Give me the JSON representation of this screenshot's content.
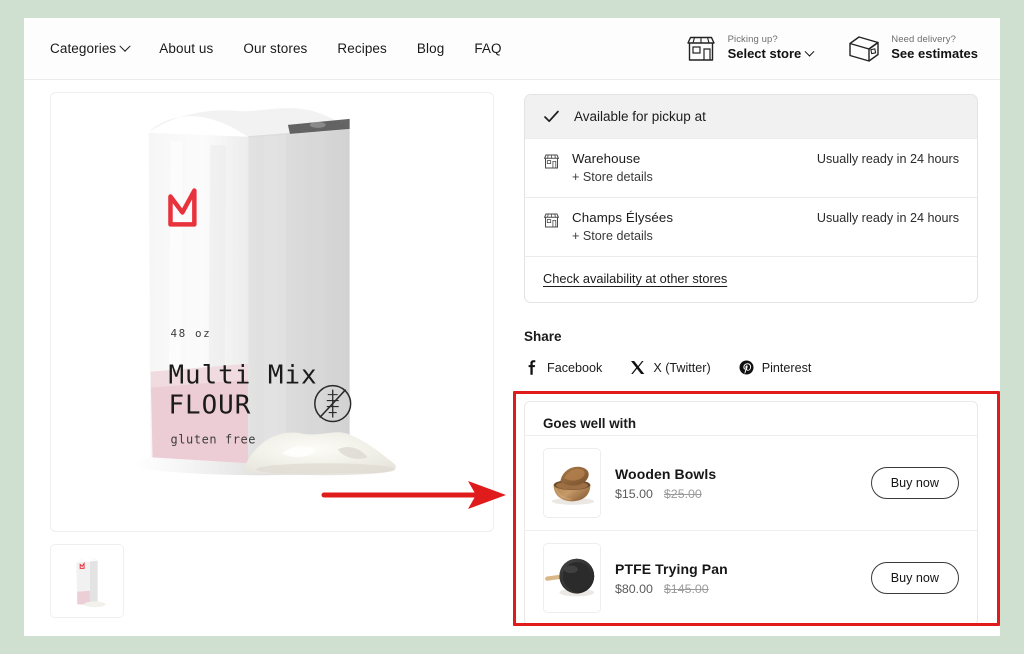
{
  "background_color": "#cfdfd0",
  "header": {
    "nav": [
      {
        "label": "Categories",
        "has_chevron": true,
        "icon": "chevron-down-icon"
      },
      {
        "label": "About us",
        "has_chevron": false
      },
      {
        "label": "Our stores",
        "has_chevron": false
      },
      {
        "label": "Recipes",
        "has_chevron": false
      },
      {
        "label": "Blog",
        "has_chevron": false
      },
      {
        "label": "FAQ",
        "has_chevron": false
      }
    ],
    "pickup": {
      "icon": "storefront-icon",
      "caption": "Picking up?",
      "action": "Select store",
      "chevron_icon": "chevron-down-icon"
    },
    "delivery": {
      "icon": "package-box-icon",
      "caption": "Need delivery?",
      "action": "See estimates"
    }
  },
  "gallery": {
    "main_image_alt": "Multi Mix Flour bag",
    "product": {
      "logo_icon": "mountain-logo-icon",
      "size": "48 oz",
      "name_line1": "Multi Mix",
      "name_line2": "FLOUR",
      "tagline": "gluten free",
      "badge_icon": "gluten-free-icon",
      "accent_color": "#e8b9c4",
      "logo_color": "#e8323c"
    },
    "thumbnails": [
      {
        "alt": "Multi Mix Flour bag thumbnail"
      }
    ]
  },
  "pickup_panel": {
    "check_icon": "checkmark-icon",
    "heading": "Available for pickup at",
    "stores": [
      {
        "icon": "storefront-icon",
        "name": "Warehouse",
        "details_label": "+ Store details",
        "ready": "Usually ready in 24 hours"
      },
      {
        "icon": "storefront-icon",
        "name": "Champs Élysées",
        "details_label": "+ Store details",
        "ready": "Usually ready in 24 hours"
      }
    ],
    "other_stores_link": "Check availability at other stores"
  },
  "share": {
    "title": "Share",
    "items": [
      {
        "icon": "facebook-icon",
        "label": "Facebook"
      },
      {
        "icon": "x-twitter-icon",
        "label": "X (Twitter)"
      },
      {
        "icon": "pinterest-icon",
        "label": "Pinterest"
      }
    ]
  },
  "goes_well_with": {
    "title": "Goes well with",
    "items": [
      {
        "image_alt": "Wooden Bowls",
        "name": "Wooden Bowls",
        "price": "$15.00",
        "compare_at_price": "$25.00",
        "button_label": "Buy now"
      },
      {
        "image_alt": "PTFE Trying Pan",
        "name": "PTFE Trying Pan",
        "price": "$80.00",
        "compare_at_price": "$145.00",
        "button_label": "Buy now"
      }
    ]
  },
  "annotations": {
    "color": "#e01b1b",
    "highlight_box": {
      "target": "goes-well-with-section"
    },
    "arrow": {
      "direction": "right",
      "points_to": "goes-well-with-section"
    }
  }
}
